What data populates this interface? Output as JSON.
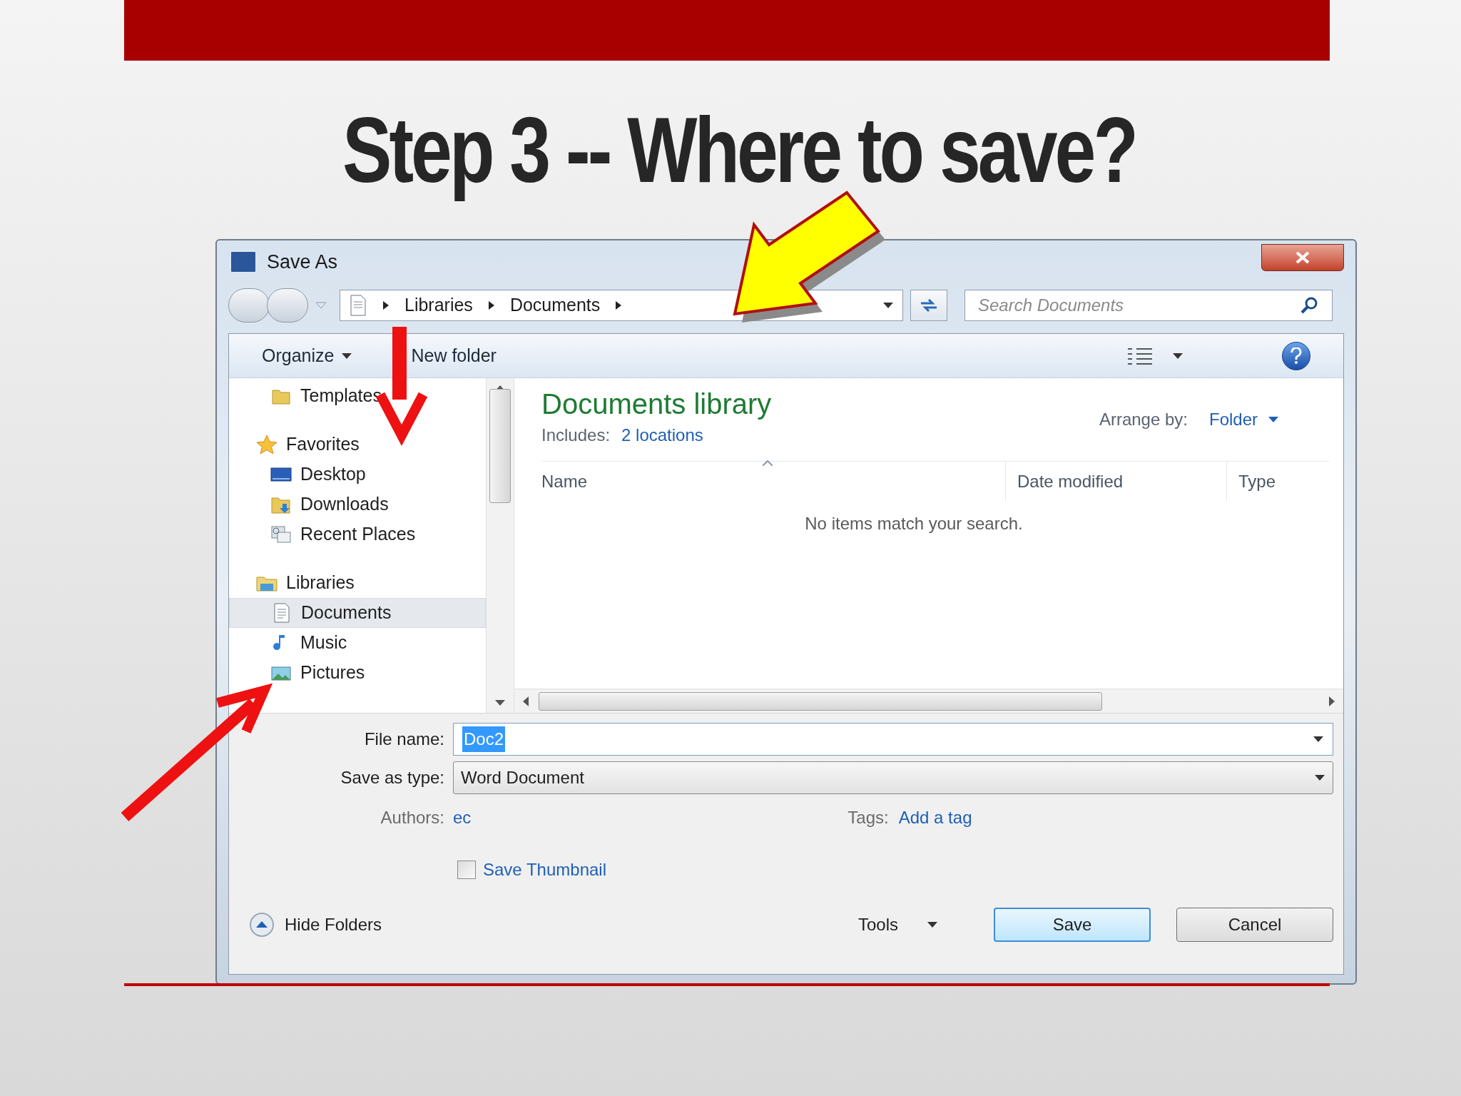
{
  "slide": {
    "title": "Step 3 -- Where to save?"
  },
  "window": {
    "title": "Save As"
  },
  "address_bar": {
    "crumbs": [
      "Libraries",
      "Documents"
    ]
  },
  "search": {
    "placeholder": "Search Documents"
  },
  "toolbar": {
    "items": [
      {
        "label": "Organize",
        "kind": "menu"
      },
      {
        "label": "New folder",
        "kind": "button"
      }
    ]
  },
  "nav": {
    "sections": [
      {
        "children": [
          {
            "label": "Templates",
            "kind": "folder",
            "selected": false
          }
        ]
      },
      {
        "label": "Favorites",
        "kind": "star",
        "children": [
          {
            "label": "Desktop",
            "kind": "desktop",
            "selected": false
          },
          {
            "label": "Downloads",
            "kind": "downloads",
            "selected": false
          },
          {
            "label": "Recent Places",
            "kind": "recent",
            "selected": false
          }
        ]
      },
      {
        "label": "Libraries",
        "kind": "library",
        "children": [
          {
            "label": "Documents",
            "kind": "document",
            "selected": true
          },
          {
            "label": "Music",
            "kind": "music",
            "selected": false
          },
          {
            "label": "Pictures",
            "kind": "pictures",
            "selected": false
          }
        ]
      }
    ]
  },
  "library": {
    "title": "Documents library",
    "includes_label": "Includes:",
    "includes_link": "2 locations",
    "arrange_label": "Arrange by:",
    "arrange_value": "Folder"
  },
  "columns": [
    "Name",
    "Date modified",
    "Type"
  ],
  "empty_message": "No items match your search.",
  "form": {
    "file_name": {
      "label": "File name:",
      "value": "Doc2",
      "text_selected": true
    },
    "save_type": {
      "label": "Save as type:",
      "value": "Word Document"
    },
    "authors": {
      "label": "Authors:",
      "value": "ec"
    },
    "tags": {
      "label": "Tags:",
      "value": "Add a tag"
    },
    "thumbnail": {
      "label": "Save Thumbnail",
      "checked": false
    }
  },
  "footer": {
    "hide_folders": "Hide Folders",
    "tools": "Tools",
    "buttons": [
      {
        "label": "Save",
        "default": true
      },
      {
        "label": "Cancel",
        "default": false
      }
    ]
  }
}
